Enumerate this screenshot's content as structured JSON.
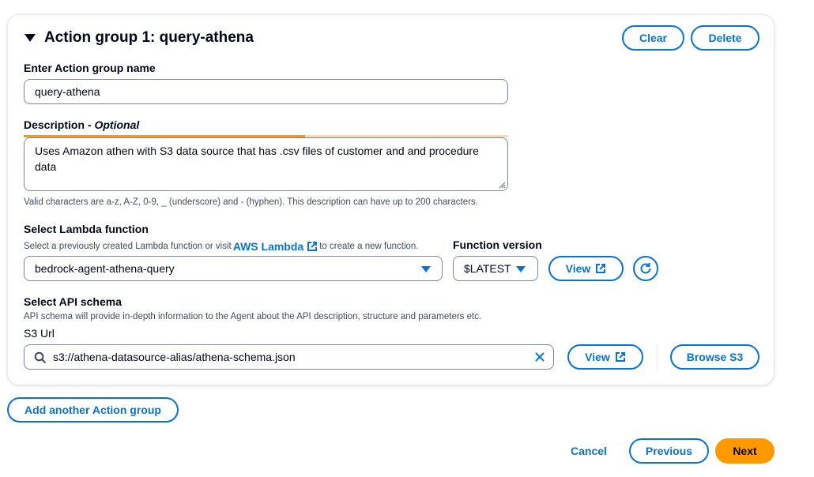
{
  "action_group": {
    "title": "Action group 1: query-athena",
    "clear_label": "Clear",
    "delete_label": "Delete",
    "name_label": "Enter Action group name",
    "name_value": "query-athena",
    "description_label": "Description - ",
    "description_optional": "Optional",
    "description_value": "Uses Amazon athen with S3 data source that has .csv files of customer and and procedure data",
    "description_progress": 0.58,
    "description_hint": "Valid characters are a-z, A-Z, 0-9, _ (underscore) and - (hyphen). This description can have up to 200 characters.",
    "lambda_label": "Select Lambda function",
    "lambda_hint_before": "Select a previously created Lambda function or visit ",
    "lambda_link": "AWS Lambda",
    "lambda_hint_after": " to create a new function.",
    "lambda_value": "bedrock-agent-athena-query",
    "version_label": "Function version",
    "version_value": "$LATEST",
    "view_label": "View",
    "schema_label": "Select API schema",
    "schema_hint": "API schema will provide in-depth information to the Agent about the API description, structure and parameters etc.",
    "s3_label": "S3 Url",
    "s3_value": "s3://athena-datasource-alias/athena-schema.json",
    "s3_view_label": "View",
    "browse_label": "Browse S3"
  },
  "add_group_label": "Add another Action group",
  "footer": {
    "cancel_label": "Cancel",
    "previous_label": "Previous",
    "next_label": "Next"
  },
  "colors": {
    "accent": "#0972d3",
    "primary": "#ff9900",
    "text": "#000716"
  },
  "icons": [
    "caret-down-icon",
    "external-link-icon",
    "refresh-icon",
    "search-icon",
    "clear-x-icon",
    "resize-handle-icon"
  ]
}
